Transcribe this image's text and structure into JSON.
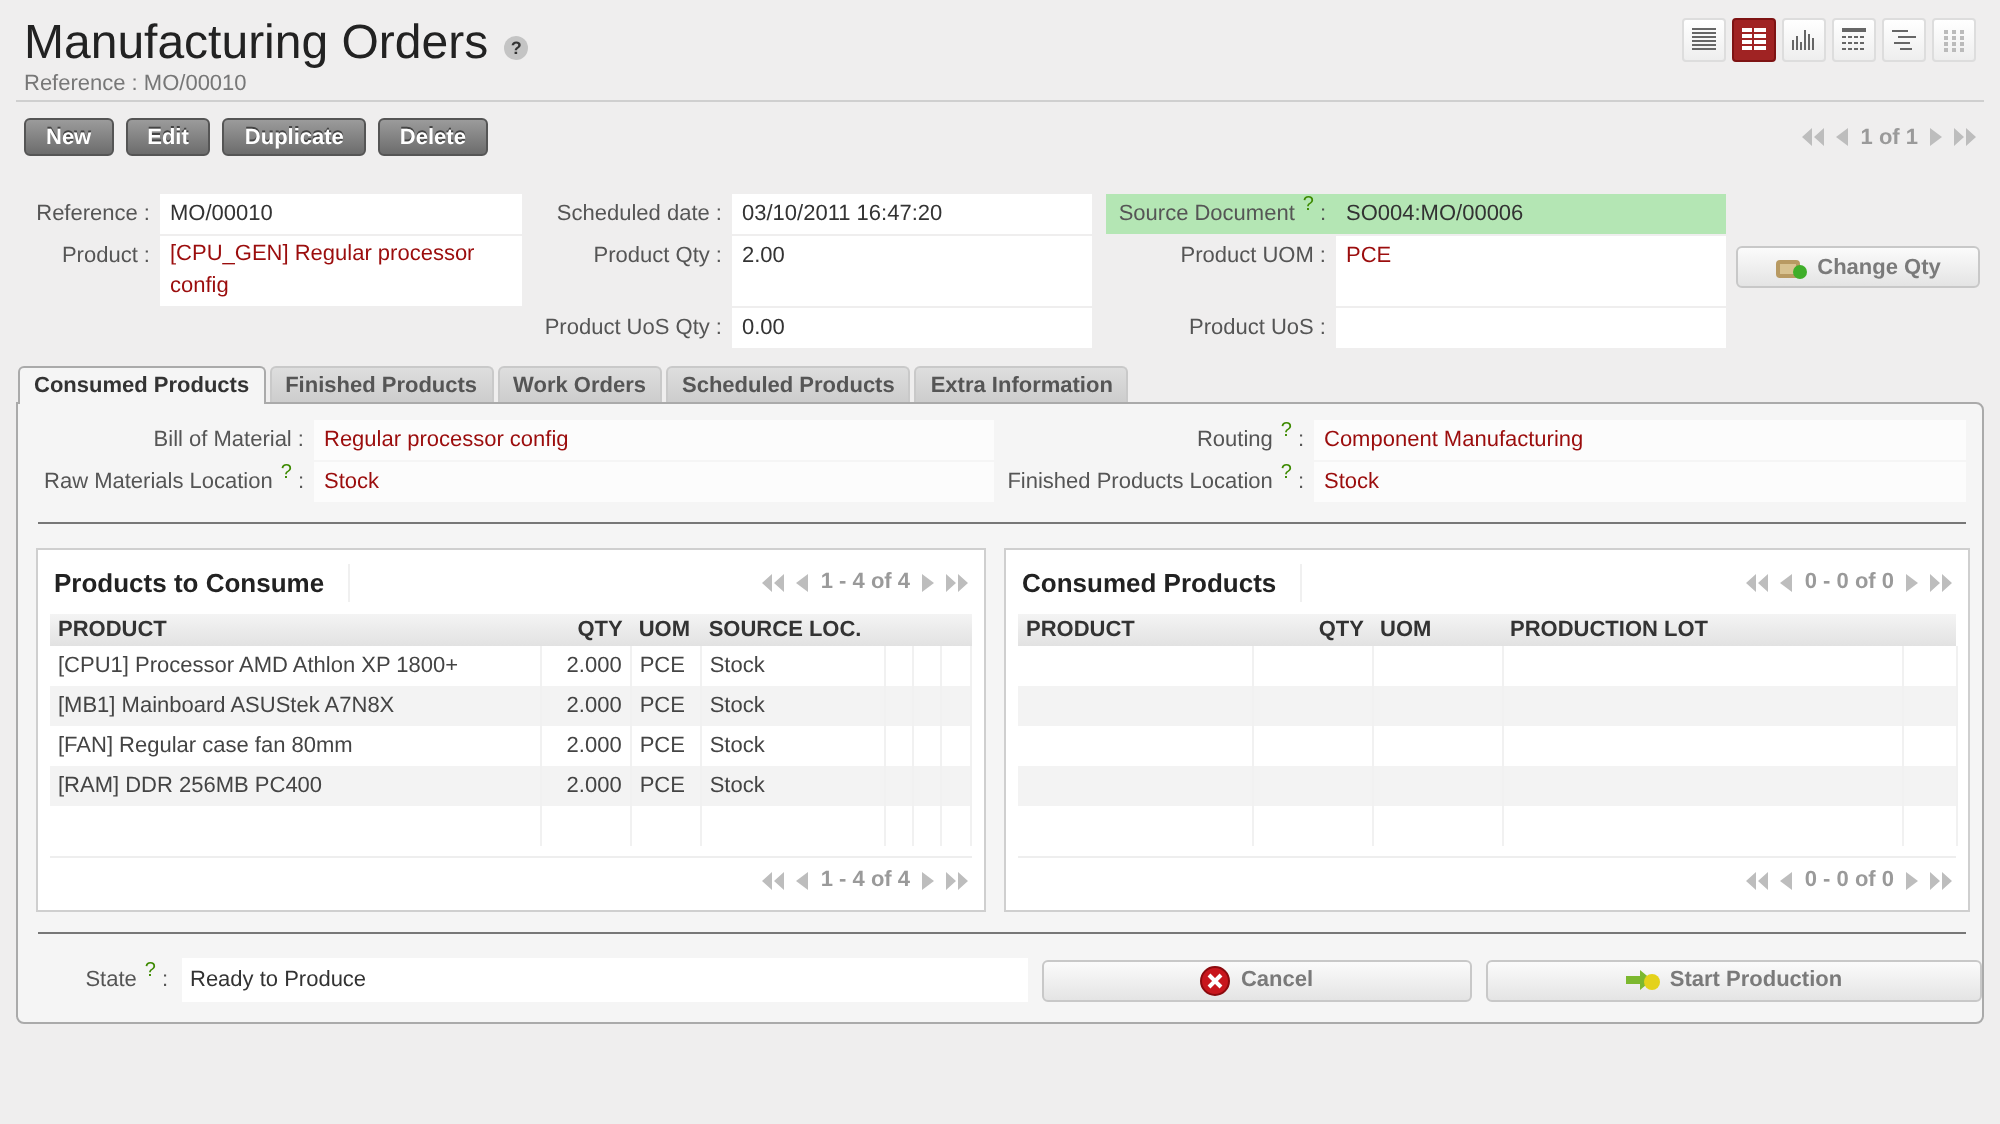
{
  "header": {
    "title": "Manufacturing Orders",
    "help": "?",
    "subtitle": "Reference : MO/00010"
  },
  "views": [
    {
      "kind": "list",
      "selected": false
    },
    {
      "kind": "form",
      "selected": true
    },
    {
      "kind": "graph",
      "selected": false
    },
    {
      "kind": "calendar",
      "selected": false
    },
    {
      "kind": "gantt",
      "selected": false
    },
    {
      "kind": "dots",
      "selected": false
    }
  ],
  "toolbar": {
    "buttons": [
      "New",
      "Edit",
      "Duplicate",
      "Delete"
    ],
    "pager": "1 of 1"
  },
  "form_head": {
    "columns": [
      [
        {
          "label": "Reference :",
          "value": "MO/00010",
          "kind": "text"
        },
        {
          "label": "Product :",
          "value": "[CPU_GEN] Regular processor config",
          "kind": "relation"
        }
      ],
      [
        {
          "label": "Scheduled date :",
          "value": "03/10/2011 16:47:20",
          "kind": "text"
        },
        {
          "label": "Product Qty :",
          "value": "2.00",
          "kind": "text"
        },
        {
          "label": "Product UoS Qty :",
          "value": "0.00",
          "kind": "text"
        }
      ],
      [
        {
          "label": "Source Document",
          "help": "?",
          "colon": ":",
          "value": "SO004:MO/00006",
          "kind": "highlighted"
        },
        {
          "label": "Product UOM :",
          "value": "PCE",
          "kind": "relation"
        },
        {
          "label": "Product UoS :",
          "kind": "text"
        }
      ]
    ],
    "button": "Change Qty"
  },
  "tabs": [
    {
      "label": "Consumed Products",
      "selected": true
    },
    {
      "label": "Finished Products",
      "selected": false
    },
    {
      "label": "Work Orders",
      "selected": false
    },
    {
      "label": "Scheduled Products",
      "selected": false
    },
    {
      "label": "Extra Information",
      "selected": false
    }
  ],
  "tab_fields": [
    {
      "label": "Bill of Material :",
      "value": "Regular processor config",
      "kind": "relation"
    },
    {
      "label": "Routing",
      "help": "?",
      "colon": ":",
      "value": "Component Manufacturing",
      "kind": "relation"
    },
    {
      "label": "Raw Materials Location",
      "help": "?",
      "colon": ":",
      "value": "Stock",
      "kind": "relation"
    },
    {
      "label": "Finished Products Location",
      "help": "?",
      "colon": ":",
      "value": "Stock",
      "kind": "relation"
    }
  ],
  "grids": [
    {
      "title": "Products to Consume",
      "pager": "1 - 4 of 4",
      "bottom_pager": "1 - 4 of 4",
      "columns": [
        {
          "label": "PRODUCT",
          "kind": "text"
        },
        {
          "label": "QTY",
          "kind": "number"
        },
        {
          "label": "UOM",
          "kind": "text"
        },
        {
          "label": "SOURCE LOC.",
          "kind": "text"
        }
      ],
      "rows": [
        [
          "[CPU1] Processor AMD Athlon XP 1800+",
          "2.000",
          "PCE",
          "Stock"
        ],
        [
          "[MB1] Mainboard ASUStek A7N8X",
          "2.000",
          "PCE",
          "Stock"
        ],
        [
          "[FAN] Regular case fan 80mm",
          "2.000",
          "PCE",
          "Stock"
        ],
        [
          "[RAM] DDR 256MB PC400",
          "2.000",
          "PCE",
          "Stock"
        ]
      ]
    },
    {
      "title": "Consumed Products",
      "pager": "0 - 0 of 0",
      "bottom_pager": "0 - 0 of 0",
      "columns": [
        {
          "label": "PRODUCT",
          "kind": "text"
        },
        {
          "label": "QTY",
          "kind": "number"
        },
        {
          "label": "UOM",
          "kind": "text"
        },
        {
          "label": "PRODUCTION LOT",
          "kind": "text"
        }
      ]
    }
  ],
  "footer": {
    "state_label": "State",
    "state_help": "?",
    "state_colon": ":",
    "state_value": "Ready to Produce",
    "buttons": [
      {
        "label": "Cancel",
        "kind": "cancel"
      },
      {
        "label": "Start Production",
        "kind": "start"
      }
    ]
  }
}
